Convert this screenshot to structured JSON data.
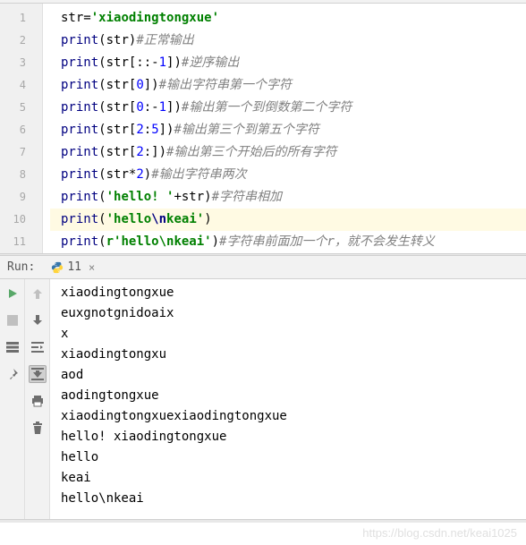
{
  "editor": {
    "lines": [
      {
        "num": 1,
        "tokens": [
          [
            "op",
            "str"
          ],
          [
            "op",
            "="
          ],
          [
            "str",
            "'xiaodingtongxue'"
          ]
        ]
      },
      {
        "num": 2,
        "tokens": [
          [
            "fn",
            "print"
          ],
          [
            "op",
            "(str)"
          ],
          [
            "cmt",
            "#正常输出"
          ]
        ]
      },
      {
        "num": 3,
        "tokens": [
          [
            "fn",
            "print"
          ],
          [
            "op",
            "(str[::-"
          ],
          [
            "num",
            "1"
          ],
          [
            "op",
            "])"
          ],
          [
            "cmt",
            "#逆序输出"
          ]
        ]
      },
      {
        "num": 4,
        "tokens": [
          [
            "fn",
            "print"
          ],
          [
            "op",
            "(str["
          ],
          [
            "num",
            "0"
          ],
          [
            "op",
            "])"
          ],
          [
            "cmt",
            "#输出字符串第一个字符"
          ]
        ]
      },
      {
        "num": 5,
        "tokens": [
          [
            "fn",
            "print"
          ],
          [
            "op",
            "(str["
          ],
          [
            "num",
            "0"
          ],
          [
            "op",
            ":-"
          ],
          [
            "num",
            "1"
          ],
          [
            "op",
            "])"
          ],
          [
            "cmt",
            "#输出第一个到倒数第二个字符"
          ]
        ]
      },
      {
        "num": 6,
        "tokens": [
          [
            "fn",
            "print"
          ],
          [
            "op",
            "(str["
          ],
          [
            "num",
            "2"
          ],
          [
            "op",
            ":"
          ],
          [
            "num",
            "5"
          ],
          [
            "op",
            "])"
          ],
          [
            "cmt",
            "#输出第三个到第五个字符"
          ]
        ]
      },
      {
        "num": 7,
        "tokens": [
          [
            "fn",
            "print"
          ],
          [
            "op",
            "(str["
          ],
          [
            "num",
            "2"
          ],
          [
            "op",
            ":])"
          ],
          [
            "cmt",
            "#输出第三个开始后的所有字符"
          ]
        ]
      },
      {
        "num": 8,
        "tokens": [
          [
            "fn",
            "print"
          ],
          [
            "op",
            "(str*"
          ],
          [
            "num",
            "2"
          ],
          [
            "op",
            ")"
          ],
          [
            "cmt",
            "#输出字符串两次"
          ]
        ]
      },
      {
        "num": 9,
        "tokens": [
          [
            "fn",
            "print"
          ],
          [
            "op",
            "("
          ],
          [
            "str",
            "'hello! '"
          ],
          [
            "op",
            "+str)"
          ],
          [
            "cmt",
            "#字符串相加"
          ]
        ]
      },
      {
        "num": 10,
        "hl": true,
        "tokens": [
          [
            "fn",
            "print"
          ],
          [
            "op",
            "("
          ],
          [
            "str",
            "'hello"
          ],
          [
            "esc",
            "\\n"
          ],
          [
            "str",
            "keai'"
          ],
          [
            "op",
            ")"
          ]
        ]
      },
      {
        "num": 11,
        "tokens": [
          [
            "fn",
            "print"
          ],
          [
            "op",
            "("
          ],
          [
            "str",
            "r'hello\\nkeai'"
          ],
          [
            "op",
            ")"
          ],
          [
            "cmt",
            "#字符串前面加一个r，就不会发生转义"
          ]
        ]
      }
    ]
  },
  "run": {
    "label": "Run:",
    "tab_name": "11",
    "output": [
      "xiaodingtongxue",
      "euxgnotgnidoaix",
      "x",
      "xiaodingtongxu",
      "aod",
      "aodingtongxue",
      "xiaodingtongxuexiaodingtongxue",
      "hello! xiaodingtongxue",
      "hello",
      "keai",
      "hello\\nkeai"
    ]
  },
  "watermark": "https://blog.csdn.net/keai1025"
}
